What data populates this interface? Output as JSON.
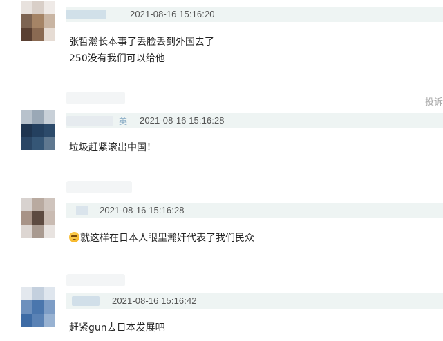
{
  "report_label": "投诉",
  "comments": [
    {
      "name_tail": "",
      "timestamp": "2021-08-16 15:16:20",
      "lines": [
        "张哲瀚长本事了丢脸丢到外国去了",
        "250没有我们可以给他"
      ]
    },
    {
      "name_tail": "英",
      "timestamp": "2021-08-16 15:16:28",
      "lines": [
        "垃圾赶紧滚出中国！"
      ]
    },
    {
      "name_tail": "",
      "timestamp": "2021-08-16 15:16:28",
      "emoji": "sad-face-icon",
      "lines": [
        "就这样在日本人眼里瀚奸代表了我们民众"
      ]
    },
    {
      "name_tail": "",
      "timestamp": "2021-08-16 15:16:42",
      "lines": [
        "赶紧gun去日本发展吧"
      ]
    }
  ],
  "colors": {
    "meta_bar": "#eef4f3",
    "timestamp": "#555555",
    "report": "#aaaaaa"
  }
}
